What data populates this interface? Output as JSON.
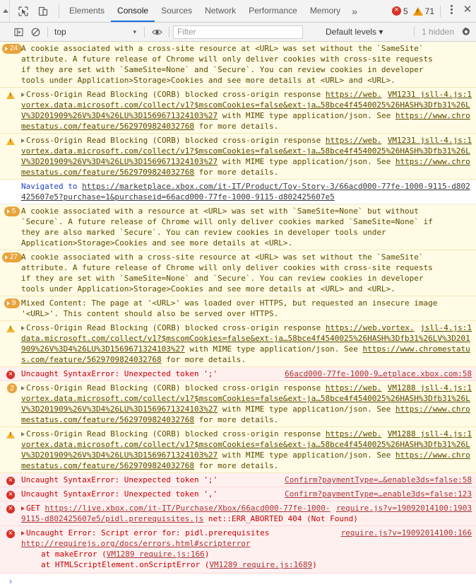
{
  "window": {
    "title": "Chrome DevTools Console"
  },
  "tabbar": {
    "inspect_icon": "inspect-element-icon",
    "device_icon": "device-toolbar-icon",
    "tabs": [
      {
        "label": "Elements",
        "active": false
      },
      {
        "label": "Console",
        "active": true
      },
      {
        "label": "Sources",
        "active": false
      },
      {
        "label": "Network",
        "active": false
      },
      {
        "label": "Performance",
        "active": false
      },
      {
        "label": "Memory",
        "active": false
      }
    ],
    "more_tabs_label": "»",
    "error_count": "5",
    "warning_count": "71",
    "menu_icon": "kebab-menu-icon",
    "close_icon": "close-icon",
    "accent_color": "#1a73e8",
    "error_color": "#d93025",
    "warning_color": "#f29900"
  },
  "filterbar": {
    "sidebar_toggle_icon": "console-sidebar-icon",
    "clear_icon": "clear-console-icon",
    "context_selected": "top",
    "context_caret": "▾",
    "eye_icon": "live-expression-icon",
    "filter_placeholder": "Filter",
    "filter_value": "",
    "levels_label": "Default levels ▾",
    "hidden_label": "1 hidden",
    "settings_icon": "gear-icon"
  },
  "messages": [
    {
      "id": "msg-cookie-crosssite-24",
      "kind": "warn",
      "gutter": "pill",
      "count": "24",
      "lines": [
        "A cookie associated with a cross-site resource at <URL> was set without the `SameSite`",
        "attribute. A future release of Chrome will only deliver cookies with cross-site requests",
        "if they are set with `SameSite=None` and `Secure`. You can review cookies in developer",
        "tools under Application>Storage>Cookies and see more details at <URL> and <URL>."
      ]
    },
    {
      "id": "msg-corb-1",
      "kind": "warn",
      "gutter": "triangle",
      "source": "VM1231 jsll-4.js:1",
      "text_pre": "Cross-Origin Read Blocking (CORB) blocked cross-origin response ",
      "url1": "https://",
      "url2": "web.vortex.data.microsoft.com/collect/v1?$mscomCookies=false&ext-ja…58bce4f4540025%26HASH%3Dfb31%26LV%3D201909%26V%3D4%26LU%3D1569671324103%27",
      "text_mid": " with MIME type application/json. See ",
      "url3": "https://www.chromestatus.com/feature/5629709824032768",
      "text_post": " for more details."
    },
    {
      "id": "msg-corb-2",
      "kind": "warn",
      "gutter": "triangle",
      "source": "VM1231 jsll-4.js:1",
      "text_pre": "Cross-Origin Read Blocking (CORB) blocked cross-origin response ",
      "url1": "https://",
      "url2": "web.vortex.data.microsoft.com/collect/v1?$mscomCookies=false&ext-ja…58bce4f4540025%26HASH%3Dfb31%26LV%3D201909%26V%3D4%26LU%3D1569671324103%27",
      "text_mid": " with MIME type application/json. See ",
      "url3": "https://www.chromestatus.com/feature/5629709824032768",
      "text_post": " for more details."
    },
    {
      "id": "msg-navigated",
      "kind": "info",
      "gutter": "none",
      "label": "Navigated to ",
      "url": "https://marketplace.xbox.com/it-IT/Product/Toy-Story-3/66acd000-77fe-1000-9115-d802425607e5?purchase=1&purchaseid=66acd000-77fe-1000-9115-d802425607e5"
    },
    {
      "id": "msg-cookie-samesite-none-5",
      "kind": "warn",
      "gutter": "pill",
      "count": "5",
      "lines": [
        "A cookie associated with a resource at <URL> was set with `SameSite=None` but without",
        "`Secure`. A future release of Chrome will only deliver cookies marked `SameSite=None` if",
        "they are also marked `Secure`. You can review cookies in developer tools under",
        "Application>Storage>Cookies and see more details at <URL>."
      ]
    },
    {
      "id": "msg-cookie-crosssite-27",
      "kind": "warn",
      "gutter": "pill",
      "count": "27",
      "lines": [
        "A cookie associated with a cross-site resource at <URL> was set without the `SameSite`",
        "attribute. A future release of Chrome will only deliver cookies with cross-site requests",
        "if they are set with `SameSite=None` and `Secure`. You can review cookies in developer",
        "tools under Application>Storage>Cookies and see more details at <URL> and <URL>."
      ]
    },
    {
      "id": "msg-mixed-content-9",
      "kind": "warn",
      "gutter": "pill",
      "count": "9",
      "lines": [
        "Mixed Content: The page at '<URL>' was loaded over HTTPS, but requested an insecure image",
        "'<URL>'. This content should also be served over HTTPS."
      ]
    },
    {
      "id": "msg-corb-3",
      "kind": "warn",
      "gutter": "triangle",
      "source": "jsll-4.js:1",
      "text_pre": "Cross-Origin Read Blocking (CORB) blocked cross-origin response ",
      "url1": "https://web.vor",
      "url2": "tex.data.microsoft.com/collect/v1?$mscomCookies=false&ext-ja…58bce4f4540025%26HASH%3Dfb31%26LV%3D201909%26V%3D4%26LU%3D1569671324103%27",
      "text_mid": " with MIME type application/json. See ",
      "url3": "https://www.chromestatus.com/feature/5629709824032768",
      "text_post": " for more details."
    },
    {
      "id": "msg-syntaxerror-1",
      "kind": "error",
      "gutter": "circle",
      "text": "Uncaught SyntaxError: Unexpected token ';'",
      "source": "66acd000-77fe-1000-9…etplace.xbox.com:58"
    },
    {
      "id": "msg-corb-4",
      "kind": "warn",
      "gutter": "circle-count",
      "count": "2",
      "source": "VM1288 jsll-4.js:1",
      "text_pre": "Cross-Origin Read Blocking (CORB) blocked cross-origin response ",
      "url1": "http",
      "url2": "s://web.vortex.data.microsoft.com/collect/v1?$mscomCookies=false&ext-ja…58bce4f4540025%26HASH%3Dfb31%26LV%3D201909%26V%3D4%26LU%3D1569671324103%27",
      "text_mid": " with MIME type application/json. See ",
      "url3": "https://www.chromestatus.com/feature/5629709824032768",
      "text_post": " for more details."
    },
    {
      "id": "msg-corb-5",
      "kind": "warn",
      "gutter": "triangle",
      "source": "VM1288 jsll-4.js:1",
      "text_pre": "Cross-Origin Read Blocking (CORB) blocked cross-origin response ",
      "url1": "https://",
      "url2": "web.vortex.data.microsoft.com/collect/v1?$mscomCookies=false&ext-ja…58bce4f4540025%26HASH%3Dfb31%26LV%3D201909%26V%3D4%26LU%3D1569671324103%27",
      "text_mid": " with MIME type application/json. See ",
      "url3": "https://www.chromestatus.com/feature/5629709824032768",
      "text_post": " for more details."
    },
    {
      "id": "msg-syntaxerror-2",
      "kind": "error",
      "gutter": "circle",
      "text": "Uncaught SyntaxError: Unexpected token ';'",
      "source": "Confirm?paymentType=…&enable3ds=false:58"
    },
    {
      "id": "msg-syntaxerror-3",
      "kind": "error",
      "gutter": "circle",
      "text": "Uncaught SyntaxError: Unexpected token ','",
      "source": "Confirm?paymentType=…enable3ds=false:123"
    },
    {
      "id": "msg-get-404",
      "kind": "error",
      "gutter": "circle",
      "method": "GET ",
      "url_a": "https://live.xbox.com/it-IT/Purchase/Xbox/66acd000-77fe-1",
      "url_b": "000-9115-d802425607e5/pidl.prerequisites.js",
      "status": " net::ERR_ABORTED 404 (Not Found)",
      "source": "require.js?v=19092014100:1903"
    },
    {
      "id": "msg-script-error",
      "kind": "error",
      "gutter": "circle",
      "text": "Uncaught Error: Script error for: pidl.prerequisites",
      "source": "require.js?v=19092014100:166",
      "detail_url": "http://requirejs.org/docs/errors.html#scripterror",
      "stack": [
        {
          "pre": "at makeError (",
          "link": "VM1289 require.js:166",
          "post": ")"
        },
        {
          "pre": "at HTMLScriptElement.onScriptError (",
          "link": "VM1289 require.js:1689",
          "post": ")"
        }
      ]
    }
  ],
  "prompt": {
    "chevron": "›"
  }
}
